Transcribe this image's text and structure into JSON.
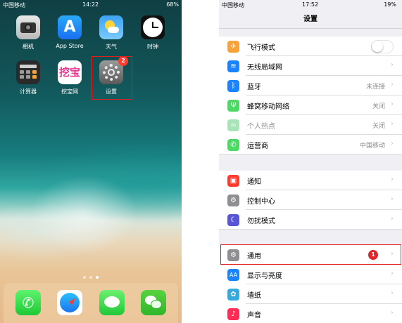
{
  "home": {
    "status": {
      "carrier": "中国移动",
      "time": "14:22",
      "battery": "68%"
    },
    "apps": [
      {
        "label": "相机",
        "icon": "camera-icon"
      },
      {
        "label": "App Store",
        "icon": "app-store-icon"
      },
      {
        "label": "天气",
        "icon": "weather-icon"
      },
      {
        "label": "时钟",
        "icon": "clock-icon"
      },
      {
        "label": "计算器",
        "icon": "calculator-icon"
      },
      {
        "label": "挖宝网",
        "icon": "wabao-icon",
        "glyph": "挖宝"
      },
      {
        "label": "设置",
        "icon": "settings-gear-icon",
        "badge": "2"
      }
    ],
    "dock": [
      "phone-icon",
      "safari-icon",
      "messages-icon",
      "wechat-icon"
    ],
    "page_indicator": {
      "pages": 3,
      "current": 3
    }
  },
  "settings": {
    "status": {
      "carrier": "中国移动",
      "time": "17:52",
      "battery": "19%"
    },
    "title": "设置",
    "groups": [
      [
        {
          "label": "飞行模式",
          "icon": "airplane-icon",
          "color": "#f7a33a",
          "toggle": false
        },
        {
          "label": "无线局域网",
          "icon": "wifi-icon",
          "color": "#1a84ff",
          "value": ""
        },
        {
          "label": "蓝牙",
          "icon": "bluetooth-icon",
          "color": "#1a84ff",
          "value": "未连接"
        },
        {
          "label": "蜂窝移动网络",
          "icon": "cellular-icon",
          "color": "#4cd964",
          "value": "关闭"
        },
        {
          "label": "个人热点",
          "icon": "hotspot-icon",
          "color": "#a9e4b8",
          "value": "关闭",
          "dim": true
        },
        {
          "label": "运营商",
          "icon": "phone-icon",
          "color": "#4cd964",
          "value": "中国移动"
        }
      ],
      [
        {
          "label": "通知",
          "icon": "notifications-icon",
          "color": "#ff3b30"
        },
        {
          "label": "控制中心",
          "icon": "control-center-icon",
          "color": "#8e8e93"
        },
        {
          "label": "勿扰模式",
          "icon": "moon-icon",
          "color": "#5856d6"
        }
      ],
      [
        {
          "label": "通用",
          "icon": "gear-icon",
          "color": "#8e8e93",
          "badge": "1"
        },
        {
          "label": "显示与亮度",
          "icon": "display-icon",
          "color": "#1a84ff"
        },
        {
          "label": "墙纸",
          "icon": "wallpaper-icon",
          "color": "#35aadc"
        },
        {
          "label": "声音",
          "icon": "sound-icon",
          "color": "#ff2d55"
        }
      ]
    ]
  },
  "glyphs": {
    "chevron": "›",
    "app_store": "A",
    "phone": "✆",
    "airplane": "✈",
    "wifi": "≋",
    "bluetooth": "ᛒ",
    "cellular": "Ψ",
    "hotspot": "∞",
    "carrier": "✆",
    "notifications": "▣",
    "control_center": "⚙",
    "moon": "☾",
    "gear": "⚙",
    "display": "AA",
    "wallpaper": "✿",
    "sound": "♪"
  }
}
